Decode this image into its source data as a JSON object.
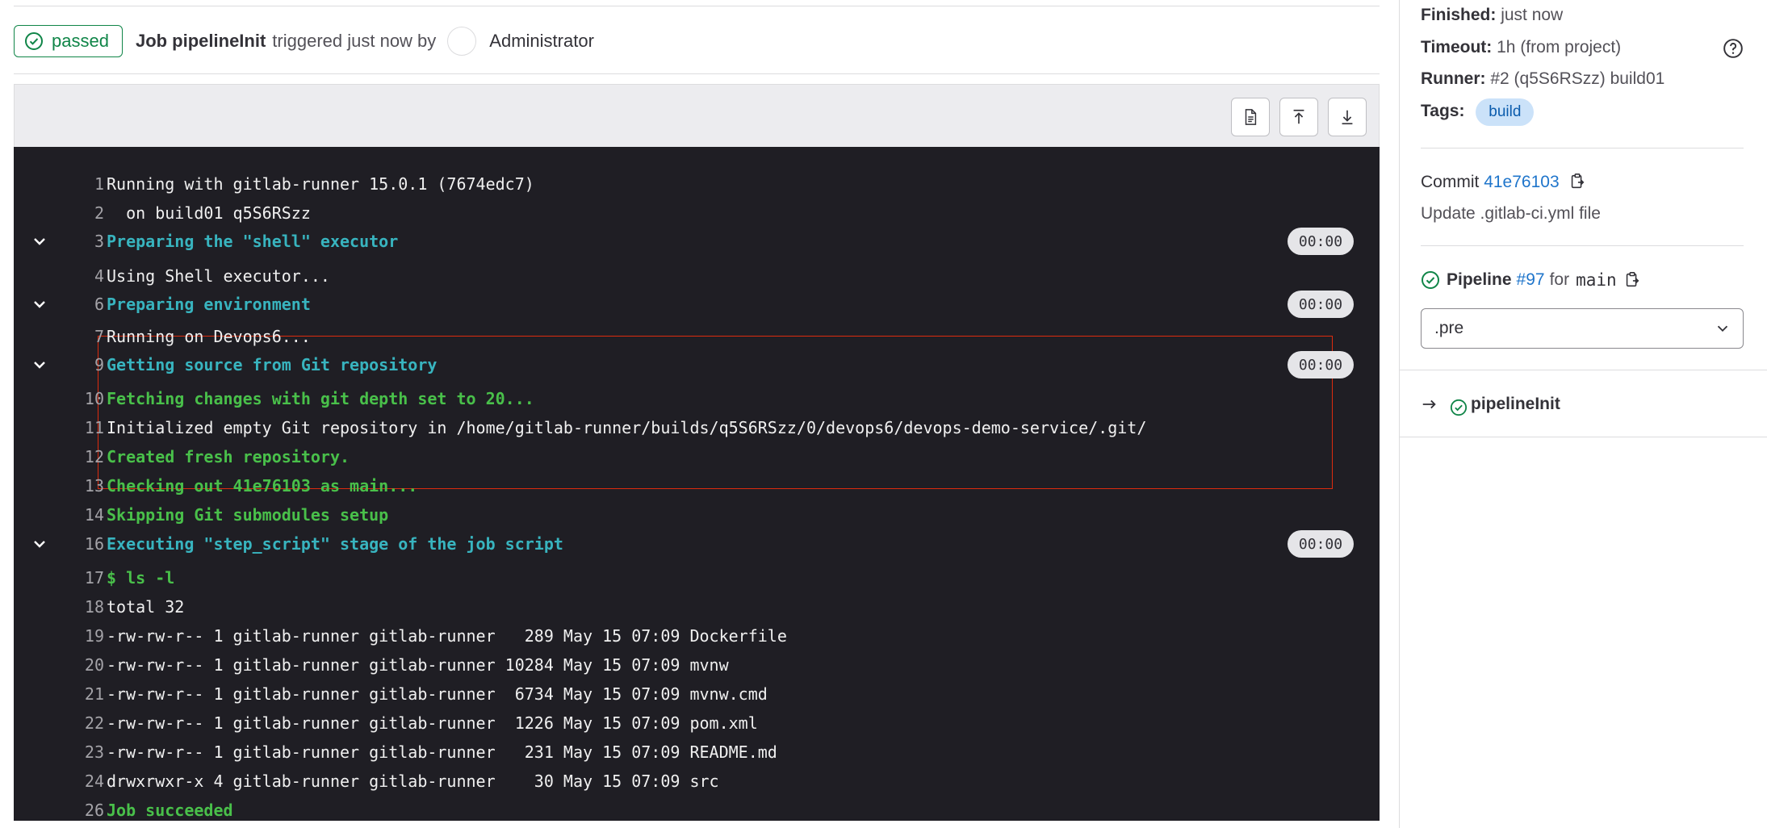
{
  "header": {
    "status": "passed",
    "job_prefix": "Job pipelineInit",
    "trigger_text": "triggered just now by",
    "user": "Administrator"
  },
  "log": {
    "lines": [
      {
        "n": "1",
        "text": "Running with gitlab-runner 15.0.1 (7674edc7)",
        "style": "white"
      },
      {
        "n": "2",
        "text": "  on build01 q5S6RSzz",
        "style": "white"
      },
      {
        "n": "3",
        "text": "Preparing the \"shell\" executor",
        "style": "cyan",
        "section": true,
        "duration": "00:00"
      },
      {
        "n": "4",
        "text": "Using Shell executor...",
        "style": "white"
      },
      {
        "n": "6",
        "text": "Preparing environment",
        "style": "cyan",
        "section": true,
        "duration": "00:00"
      },
      {
        "n": "7",
        "text": "Running on Devops6...",
        "style": "white"
      },
      {
        "n": "9",
        "text": "Getting source from Git repository",
        "style": "cyan",
        "section": true,
        "duration": "00:00"
      },
      {
        "n": "10",
        "text": "Fetching changes with git depth set to 20...",
        "style": "green"
      },
      {
        "n": "11",
        "text": "Initialized empty Git repository in /home/gitlab-runner/builds/q5S6RSzz/0/devops6/devops-demo-service/.git/",
        "style": "white"
      },
      {
        "n": "12",
        "text": "Created fresh repository.",
        "style": "green"
      },
      {
        "n": "13",
        "text": "Checking out 41e76103 as main...",
        "style": "green"
      },
      {
        "n": "14",
        "text": "Skipping Git submodules setup",
        "style": "green"
      },
      {
        "n": "16",
        "text": "Executing \"step_script\" stage of the job script",
        "style": "cyan",
        "section": true,
        "duration": "00:00"
      },
      {
        "n": "17",
        "text": "$ ls -l",
        "style": "green"
      },
      {
        "n": "18",
        "text": "total 32",
        "style": "white"
      },
      {
        "n": "19",
        "text": "-rw-rw-r-- 1 gitlab-runner gitlab-runner   289 May 15 07:09 Dockerfile",
        "style": "white"
      },
      {
        "n": "20",
        "text": "-rw-rw-r-- 1 gitlab-runner gitlab-runner 10284 May 15 07:09 mvnw",
        "style": "white"
      },
      {
        "n": "21",
        "text": "-rw-rw-r-- 1 gitlab-runner gitlab-runner  6734 May 15 07:09 mvnw.cmd",
        "style": "white"
      },
      {
        "n": "22",
        "text": "-rw-rw-r-- 1 gitlab-runner gitlab-runner  1226 May 15 07:09 pom.xml",
        "style": "white"
      },
      {
        "n": "23",
        "text": "-rw-rw-r-- 1 gitlab-runner gitlab-runner   231 May 15 07:09 README.md",
        "style": "white"
      },
      {
        "n": "24",
        "text": "drwxrwxr-x 4 gitlab-runner gitlab-runner    30 May 15 07:09 src",
        "style": "white"
      },
      {
        "n": "26",
        "text": "Job succeeded",
        "style": "green"
      }
    ]
  },
  "sidebar": {
    "finished_label": "Finished:",
    "finished_value": "just now",
    "timeout_label": "Timeout:",
    "timeout_value": "1h (from project)",
    "runner_label": "Runner:",
    "runner_value": "#2 (q5S6RSzz) build01",
    "tags_label": "Tags:",
    "tag": "build",
    "commit_label": "Commit",
    "commit_sha": "41e76103",
    "commit_message": "Update .gitlab-ci.yml file",
    "pipeline_label": "Pipeline",
    "pipeline_id": "#97",
    "pipeline_for": "for",
    "pipeline_branch": "main",
    "stage_select": ".pre",
    "job_name": "pipelineInit"
  },
  "colors": {
    "success": "#108548",
    "log_bg": "#1f1e24",
    "log_cyan": "#38b4bf",
    "log_green": "#49c04a",
    "link": "#1f75cb",
    "highlight": "#dd2b0e"
  }
}
